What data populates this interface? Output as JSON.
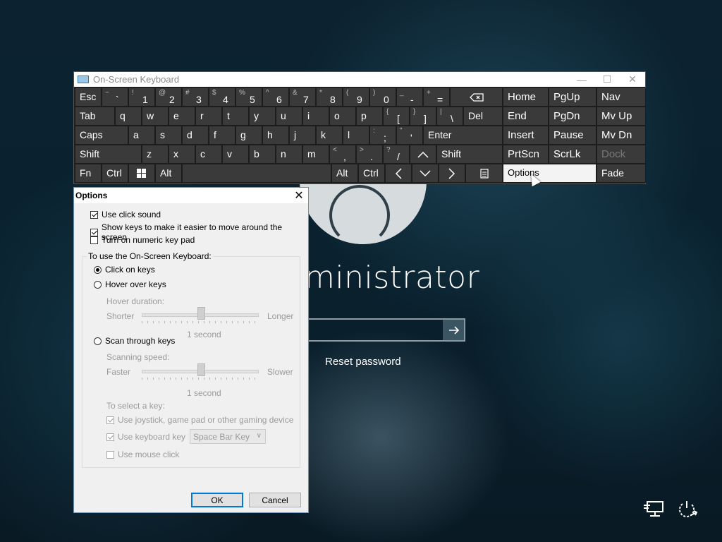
{
  "lockscreen": {
    "username": "ministrator",
    "reset_password": "Reset password",
    "submit_icon": "arrow-right-icon",
    "network_icon": "network-icon",
    "power_icon": "power-icon"
  },
  "osk": {
    "title": "On-Screen Keyboard",
    "window_controls": {
      "minimize": "—",
      "maximize": "☐",
      "close": "✕"
    },
    "row1": [
      {
        "s": "~",
        "m": "`"
      },
      {
        "s": "!",
        "m": "1"
      },
      {
        "s": "@",
        "m": "2"
      },
      {
        "s": "#",
        "m": "3"
      },
      {
        "s": "$",
        "m": "4"
      },
      {
        "s": "%",
        "m": "5"
      },
      {
        "s": "^",
        "m": "6"
      },
      {
        "s": "&",
        "m": "7"
      },
      {
        "s": "*",
        "m": "8"
      },
      {
        "s": "(",
        "m": "9"
      },
      {
        "s": ")",
        "m": "0"
      },
      {
        "s": "_",
        "m": "-"
      },
      {
        "s": "+",
        "m": "="
      }
    ],
    "row1_labels": {
      "esc": "Esc",
      "backspace_icon": "backspace-icon"
    },
    "row2_letters": [
      "q",
      "w",
      "e",
      "r",
      "t",
      "y",
      "u",
      "i",
      "o",
      "p"
    ],
    "row2_sym": [
      {
        "s": "{",
        "m": "["
      },
      {
        "s": "}",
        "m": "]"
      },
      {
        "s": "|",
        "m": "\\"
      }
    ],
    "row2_labels": {
      "tab": "Tab",
      "del": "Del"
    },
    "row3_letters": [
      "a",
      "s",
      "d",
      "f",
      "g",
      "h",
      "j",
      "k",
      "l"
    ],
    "row3_sym": [
      {
        "s": ":",
        "m": ";"
      },
      {
        "s": "\"",
        "m": "'"
      }
    ],
    "row3_labels": {
      "caps": "Caps",
      "enter": "Enter"
    },
    "row4_letters": [
      "z",
      "x",
      "c",
      "v",
      "b",
      "n",
      "m"
    ],
    "row4_sym": [
      {
        "s": "<",
        "m": ","
      },
      {
        "s": ">",
        "m": "."
      },
      {
        "s": "?",
        "m": "/"
      }
    ],
    "row4_labels": {
      "shift_left": "Shift",
      "up_icon": "arrow-up-icon",
      "shift_right": "Shift"
    },
    "row5_labels": {
      "fn": "Fn",
      "ctrl_left": "Ctrl",
      "win_icon": "windows-icon",
      "alt_left": "Alt",
      "alt_right": "Alt",
      "ctrl_right": "Ctrl",
      "left_icon": "arrow-left-icon",
      "down_icon": "arrow-down-icon",
      "right_icon": "arrow-right-icon",
      "menu_icon": "menu-key-icon"
    },
    "nav_keys": {
      "home": "Home",
      "pgup": "PgUp",
      "nav": "Nav",
      "end": "End",
      "pgdn": "PgDn",
      "mvup": "Mv Up",
      "insert": "Insert",
      "pause": "Pause",
      "mvdn": "Mv Dn",
      "prtscn": "PrtScn",
      "scrlk": "ScrLk",
      "dock": "Dock",
      "options": "Options",
      "fade": "Fade"
    }
  },
  "options": {
    "title": "Options",
    "close": "✕",
    "use_click_sound": "Use click sound",
    "show_keys": "Show keys to make it easier to move around the screen",
    "numeric_keypad": "Turn on numeric key pad",
    "group_label": "To use the On-Screen Keyboard:",
    "click_on_keys": "Click on keys",
    "hover_over_keys": "Hover over keys",
    "hover_duration": "Hover duration:",
    "shorter": "Shorter",
    "longer": "Longer",
    "hover_value": "1 second",
    "scan_through_keys": "Scan through keys",
    "scanning_speed": "Scanning speed:",
    "faster": "Faster",
    "slower": "Slower",
    "scan_value": "1 second",
    "to_select": "To select a key:",
    "use_joystick": "Use joystick, game pad or other gaming device",
    "use_keyboard_key": "Use keyboard key",
    "keyboard_key_value": "Space Bar Key",
    "use_mouse_click": "Use mouse click",
    "ok": "OK",
    "cancel": "Cancel",
    "hover_slider_fraction": 0.5,
    "scan_slider_fraction": 0.5
  }
}
